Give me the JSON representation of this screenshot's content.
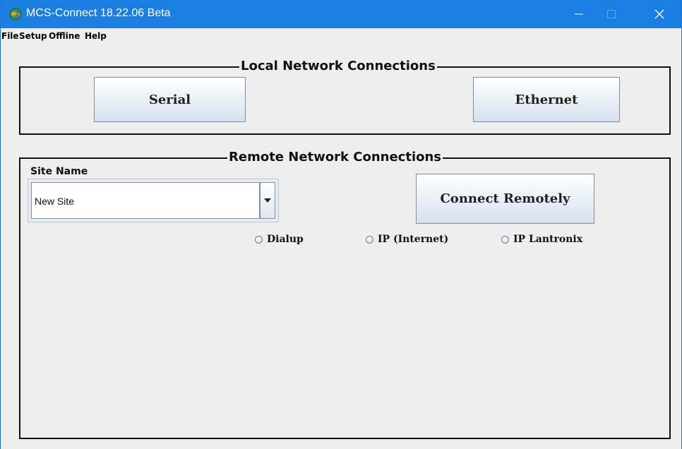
{
  "window": {
    "title": "MCS-Connect 18.22.06 Beta",
    "title_bar_color": "#1a7fe0",
    "icons": [
      "globe-app-icon",
      "minimize-icon",
      "maximize-icon",
      "close-icon"
    ]
  },
  "menu": {
    "items": [
      "File",
      "Setup",
      "Offline",
      "Help"
    ]
  },
  "local": {
    "title": "Local Network Connections",
    "serial_label": "Serial",
    "ethernet_label": "Ethernet"
  },
  "remote": {
    "title": "Remote Network Connections",
    "site_name_label": "Site Name",
    "site_selected": "New Site",
    "connect_label": "Connect Remotely",
    "radios": [
      {
        "label": "Dialup",
        "selected": false
      },
      {
        "label": "IP (Internet)",
        "selected": false
      },
      {
        "label": "IP Lantronix",
        "selected": false
      }
    ]
  }
}
